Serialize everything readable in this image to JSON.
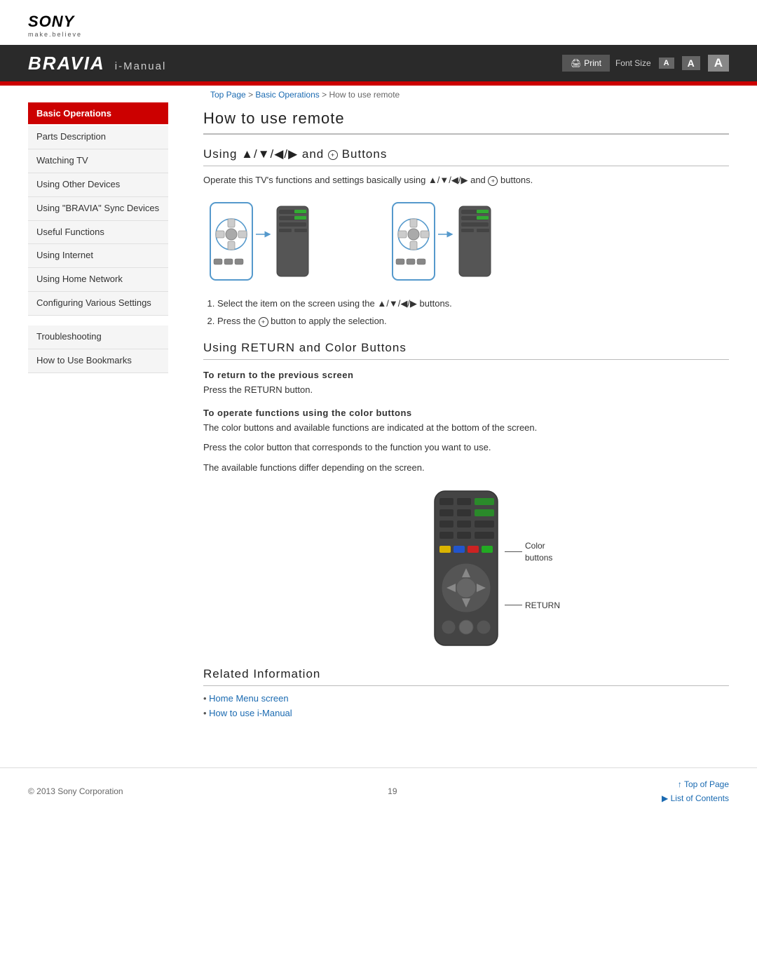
{
  "header": {
    "sony_logo": "SONY",
    "sony_tagline": "make.believe",
    "bravia": "BRAVIA",
    "imanual": "i-Manual",
    "print_label": "Print",
    "font_size_label": "Font Size",
    "font_sm": "A",
    "font_md": "A",
    "font_lg": "A"
  },
  "breadcrumb": {
    "top_page": "Top Page",
    "separator1": " > ",
    "basic_ops": "Basic Operations",
    "separator2": " > ",
    "current": "How to use remote"
  },
  "sidebar": {
    "section_header": "Basic Operations",
    "items": [
      {
        "label": "Parts Description"
      },
      {
        "label": "Watching TV"
      },
      {
        "label": "Using Other Devices"
      },
      {
        "label": "Using \"BRAVIA\" Sync Devices"
      },
      {
        "label": "Useful Functions"
      },
      {
        "label": "Using Internet"
      },
      {
        "label": "Using Home Network"
      },
      {
        "label": "Configuring Various Settings"
      }
    ],
    "secondary_items": [
      {
        "label": "Troubleshooting"
      },
      {
        "label": "How to Use Bookmarks"
      }
    ]
  },
  "content": {
    "page_title": "How to use remote",
    "section1_title": "Using ▲/▼/◀/▶ and ⊕ Buttons",
    "section1_intro": "Operate this TV's functions and settings basically using ▲/▼/◀/▶ and ⊕ buttons.",
    "step1": "Select the item on the screen using the ▲/▼/◀/▶ buttons.",
    "step2": "Press the ⊕ button to apply the selection.",
    "section2_title": "Using RETURN and Color Buttons",
    "subsection1_title": "To return to the previous screen",
    "subsection1_text": "Press the RETURN button.",
    "subsection2_title": "To operate functions using the color buttons",
    "subsection2_text1": "The color buttons and available functions are indicated at the bottom of the screen.",
    "subsection2_text2": "Press the color button that corresponds to the function you want to use.",
    "subsection2_text3": "The available functions differ depending on the screen.",
    "color_label": "Color\nbuttons",
    "return_label": "RETURN",
    "section3_title": "Related Information",
    "related_links": [
      {
        "label": "Home Menu screen"
      },
      {
        "label": "How to use i-Manual"
      }
    ]
  },
  "footer": {
    "copyright": "© 2013 Sony Corporation",
    "page_number": "19",
    "top_of_page": "Top of Page",
    "list_of_contents": "List of Contents"
  }
}
